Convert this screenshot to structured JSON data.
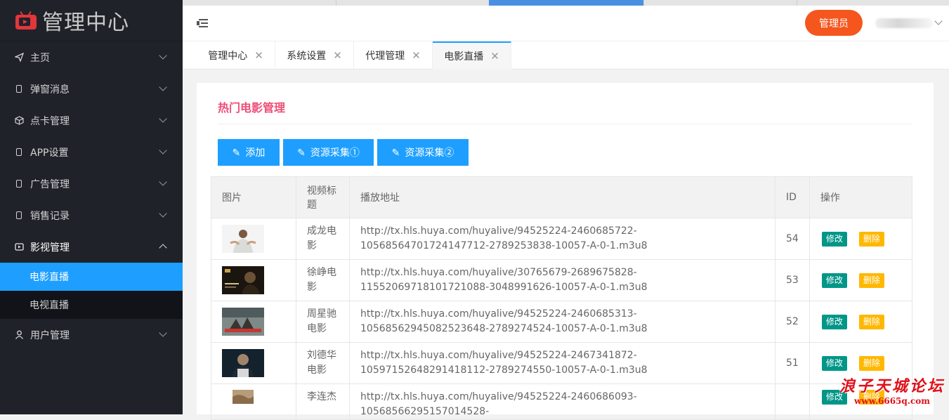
{
  "app": {
    "title": "管理中心"
  },
  "sidebar": {
    "items": [
      {
        "label": "主页",
        "icon": "paper-plane-icon"
      },
      {
        "label": "弹窗消息",
        "icon": "phone-icon"
      },
      {
        "label": "点卡管理",
        "icon": "cube-icon"
      },
      {
        "label": "APP设置",
        "icon": "phone-icon"
      },
      {
        "label": "广告管理",
        "icon": "phone-icon"
      },
      {
        "label": "销售记录",
        "icon": "phone-icon"
      },
      {
        "label": "影视管理",
        "icon": "video-icon",
        "expanded": true
      },
      {
        "label": "用户管理",
        "icon": "user-icon"
      }
    ],
    "sub_items": [
      {
        "label": "电影直播",
        "active": true
      },
      {
        "label": "电视直播",
        "active": false
      }
    ]
  },
  "header": {
    "admin_label": "管理员"
  },
  "tabs": [
    {
      "label": "管理中心"
    },
    {
      "label": "系统设置"
    },
    {
      "label": "代理管理"
    },
    {
      "label": "电影直播",
      "active": true
    }
  ],
  "main": {
    "title": "热门电影管理",
    "buttons": {
      "add": "添加",
      "collect1": "资源采集①",
      "collect2": "资源采集②"
    },
    "table": {
      "headers": [
        "图片",
        "视频标题",
        "播放地址",
        "ID",
        "操作"
      ],
      "edit_label": "修改",
      "delete_label": "删除",
      "rows": [
        {
          "title": "成龙电影",
          "url": "http://tx.hls.huya.com/huyalive/94525224-2460685722-10568564701724147712-2789253838-10057-A-0-1.m3u8",
          "id": "54"
        },
        {
          "title": "徐峥电影",
          "url": "http://tx.hls.huya.com/huyalive/30765679-2689675828-11552069718101721088-3048991626-10057-A-0-1.m3u8",
          "id": "53"
        },
        {
          "title": "周星驰电影",
          "url": "http://tx.hls.huya.com/huyalive/94525224-2460685313-10568562945082523648-2789274524-10057-A-0-1.m3u8",
          "id": "52"
        },
        {
          "title": "刘德华电影",
          "url": "http://tx.hls.huya.com/huyalive/94525224-2467341872-10597152648291418112-2789274550-10057-A-0-1.m3u8",
          "id": "51"
        },
        {
          "title": "李连杰",
          "url": "http://tx.hls.huya.com/huyalive/94525224-2460686093-10568566295157014528-",
          "id": ""
        }
      ]
    }
  },
  "watermark": {
    "line1": "浪子天城论坛",
    "line2": "www.6665q.com"
  },
  "colors": {
    "accent": "#1e9fff",
    "admin": "#f5561e",
    "title": "#ef4d76",
    "edit": "#009688",
    "delete": "#ffb800",
    "sidebar": "#20222a"
  }
}
